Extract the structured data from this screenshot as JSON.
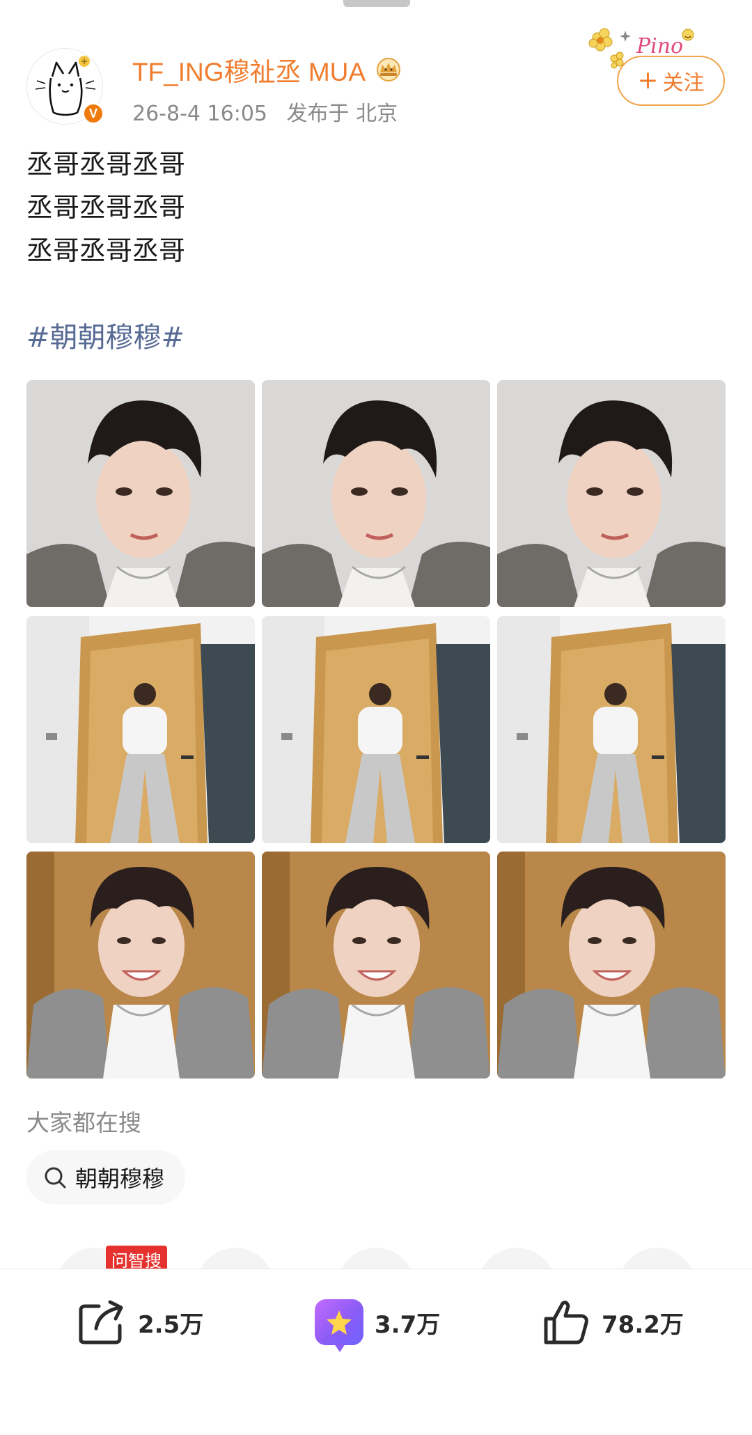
{
  "author": {
    "username": "TF_ING穆祉丞 MUA",
    "verified_mark": "V",
    "badge_icon": "crown-member-icon"
  },
  "post": {
    "time": "26-8-4 16:05",
    "location": "发布于 北京",
    "lines": [
      "丞哥丞哥丞哥",
      "丞哥丞哥丞哥",
      "丞哥丞哥丞哥"
    ],
    "hashtag": "#朝朝穆穆#",
    "photos": [
      {
        "subject": "closeup-portrait"
      },
      {
        "subject": "closeup-portrait"
      },
      {
        "subject": "closeup-portrait"
      },
      {
        "subject": "full-body-door"
      },
      {
        "subject": "full-body-door"
      },
      {
        "subject": "full-body-door"
      },
      {
        "subject": "smiling-selfie"
      },
      {
        "subject": "smiling-selfie"
      },
      {
        "subject": "smiling-selfie"
      }
    ]
  },
  "follow": {
    "label": "关注",
    "decoration_text": "Pino"
  },
  "search": {
    "heading": "大家都在搜",
    "chip_label": "朝朝穆穆"
  },
  "ask_badge": "问智搜",
  "actions": {
    "share_count": "2.5万",
    "favorite_count": "3.7万",
    "like_count": "78.2万"
  },
  "colors": {
    "username": "#f07c2d",
    "hashtag": "#576b95",
    "follow_border": "#f0a44a",
    "ask_badge": "#e5322e",
    "favorite_gradient": "#8b5cf6"
  }
}
